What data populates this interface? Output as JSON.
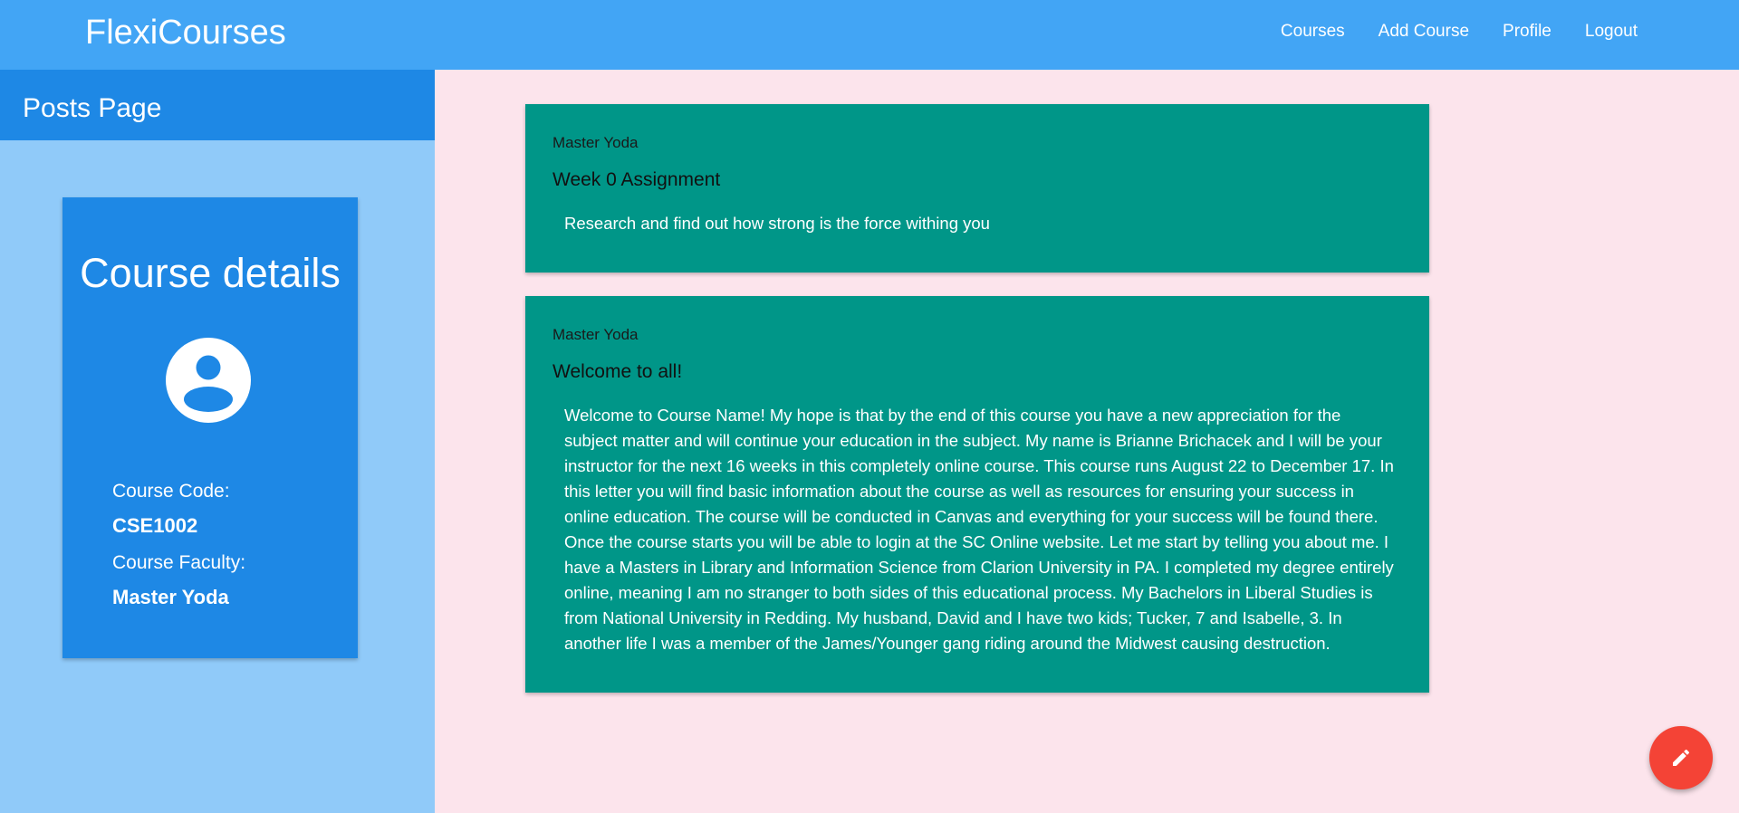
{
  "navbar": {
    "brand": "FlexiCourses",
    "links": [
      "Courses",
      "Add Course",
      "Profile",
      "Logout"
    ]
  },
  "sidebar": {
    "title": "Posts Page",
    "course_card": {
      "title": "Course details",
      "code_label": "Course Code:",
      "code_value": "CSE1002",
      "faculty_label": "Course Faculty:",
      "faculty_value": "Master Yoda"
    }
  },
  "posts": [
    {
      "author": "Master Yoda",
      "title": "Week 0 Assignment",
      "body": "Research and find out how strong is the force withing you"
    },
    {
      "author": "Master Yoda",
      "title": "Welcome to all!",
      "body": "Welcome to Course Name! My hope is that by the end of this course you have a new appreciation for the subject matter and will continue your education in the subject. My name is Brianne Brichacek and I will be your instructor for the next 16 weeks in this completely online course. This course runs August 22 to December 17. In this letter you will find basic information about the course as well as resources for ensuring your success in online education. The course will be conducted in Canvas and everything for your success will be found there. Once the course starts you will be able to login at the SC Online website. Let me start by telling you about me. I have a Masters in Library and Information Science from Clarion University in PA. I completed my degree entirely online, meaning I am no stranger to both sides of this educational process. My Bachelors in Liberal Studies is from National University in Redding. My husband, David and I have two kids; Tucker, 7 and Isabelle, 3. In another life I was a member of the James/Younger gang riding around the Midwest causing destruction."
    }
  ],
  "fab": {
    "icon": "pencil-icon"
  },
  "colors": {
    "navbar": "#42a5f5",
    "sidebar": "#90caf9",
    "sidebar_header": "#1e88e5",
    "post_card": "#009688",
    "fab": "#f44336",
    "page_bg": "#fce4ec"
  }
}
